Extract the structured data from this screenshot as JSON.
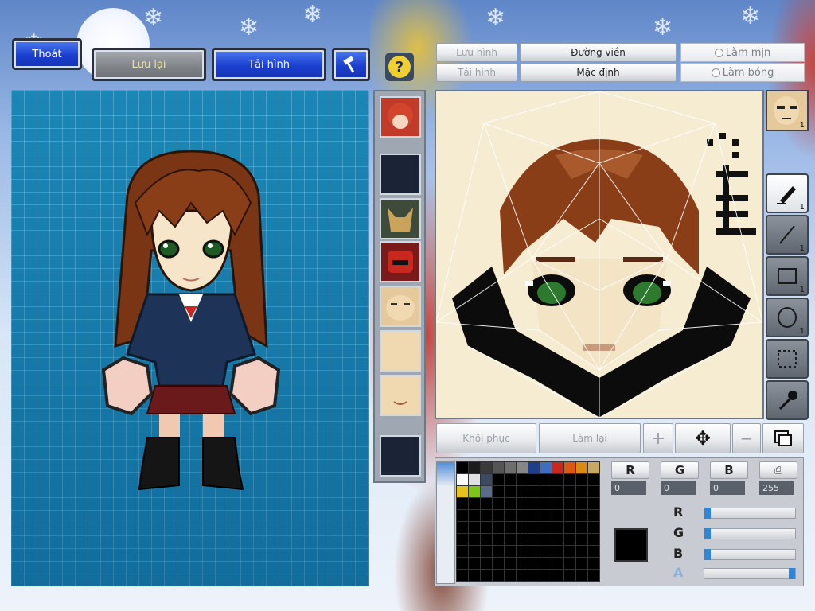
{
  "top_buttons": {
    "exit": "Thoát",
    "save": "Lưu lại",
    "reload": "Tải hình"
  },
  "editor_buttons": {
    "save_image": "Lưu hình",
    "load_image": "Tải hình",
    "outline": "Đường viền",
    "default": "Mặc định",
    "smooth": "Làm mịn",
    "shine": "Làm bóng",
    "restore": "Khôi phục",
    "redo": "Làm lại"
  },
  "tools": {
    "avatar_count": "1",
    "brush_count": "1",
    "line_count": "1",
    "rect_count": "1",
    "ellipse_count": "1"
  },
  "color": {
    "r_label": "R",
    "g_label": "G",
    "b_label": "B",
    "a_label": "A",
    "r_value": "0",
    "g_value": "0",
    "b_value": "0",
    "a_value": "255",
    "current": "#000000",
    "r_fraction": 0,
    "g_fraction": 0,
    "b_fraction": 0,
    "a_fraction": 1
  },
  "palette": [
    "#000000",
    "#1c1c1c",
    "#3a3a3a",
    "#555555",
    "#6e6e6e",
    "#878787",
    "#1f3f8a",
    "#3e6fbf",
    "#c8281e",
    "#d85a14",
    "#d98a14",
    "#c8a864",
    "#ffffff",
    "#e0e0e0",
    "#3a4a62",
    "#000000",
    "#000000",
    "#000000",
    "#000000",
    "#000000",
    "#000000",
    "#000000",
    "#000000",
    "#000000",
    "#e6c21a",
    "#7ec21a",
    "#5a6a8a"
  ]
}
